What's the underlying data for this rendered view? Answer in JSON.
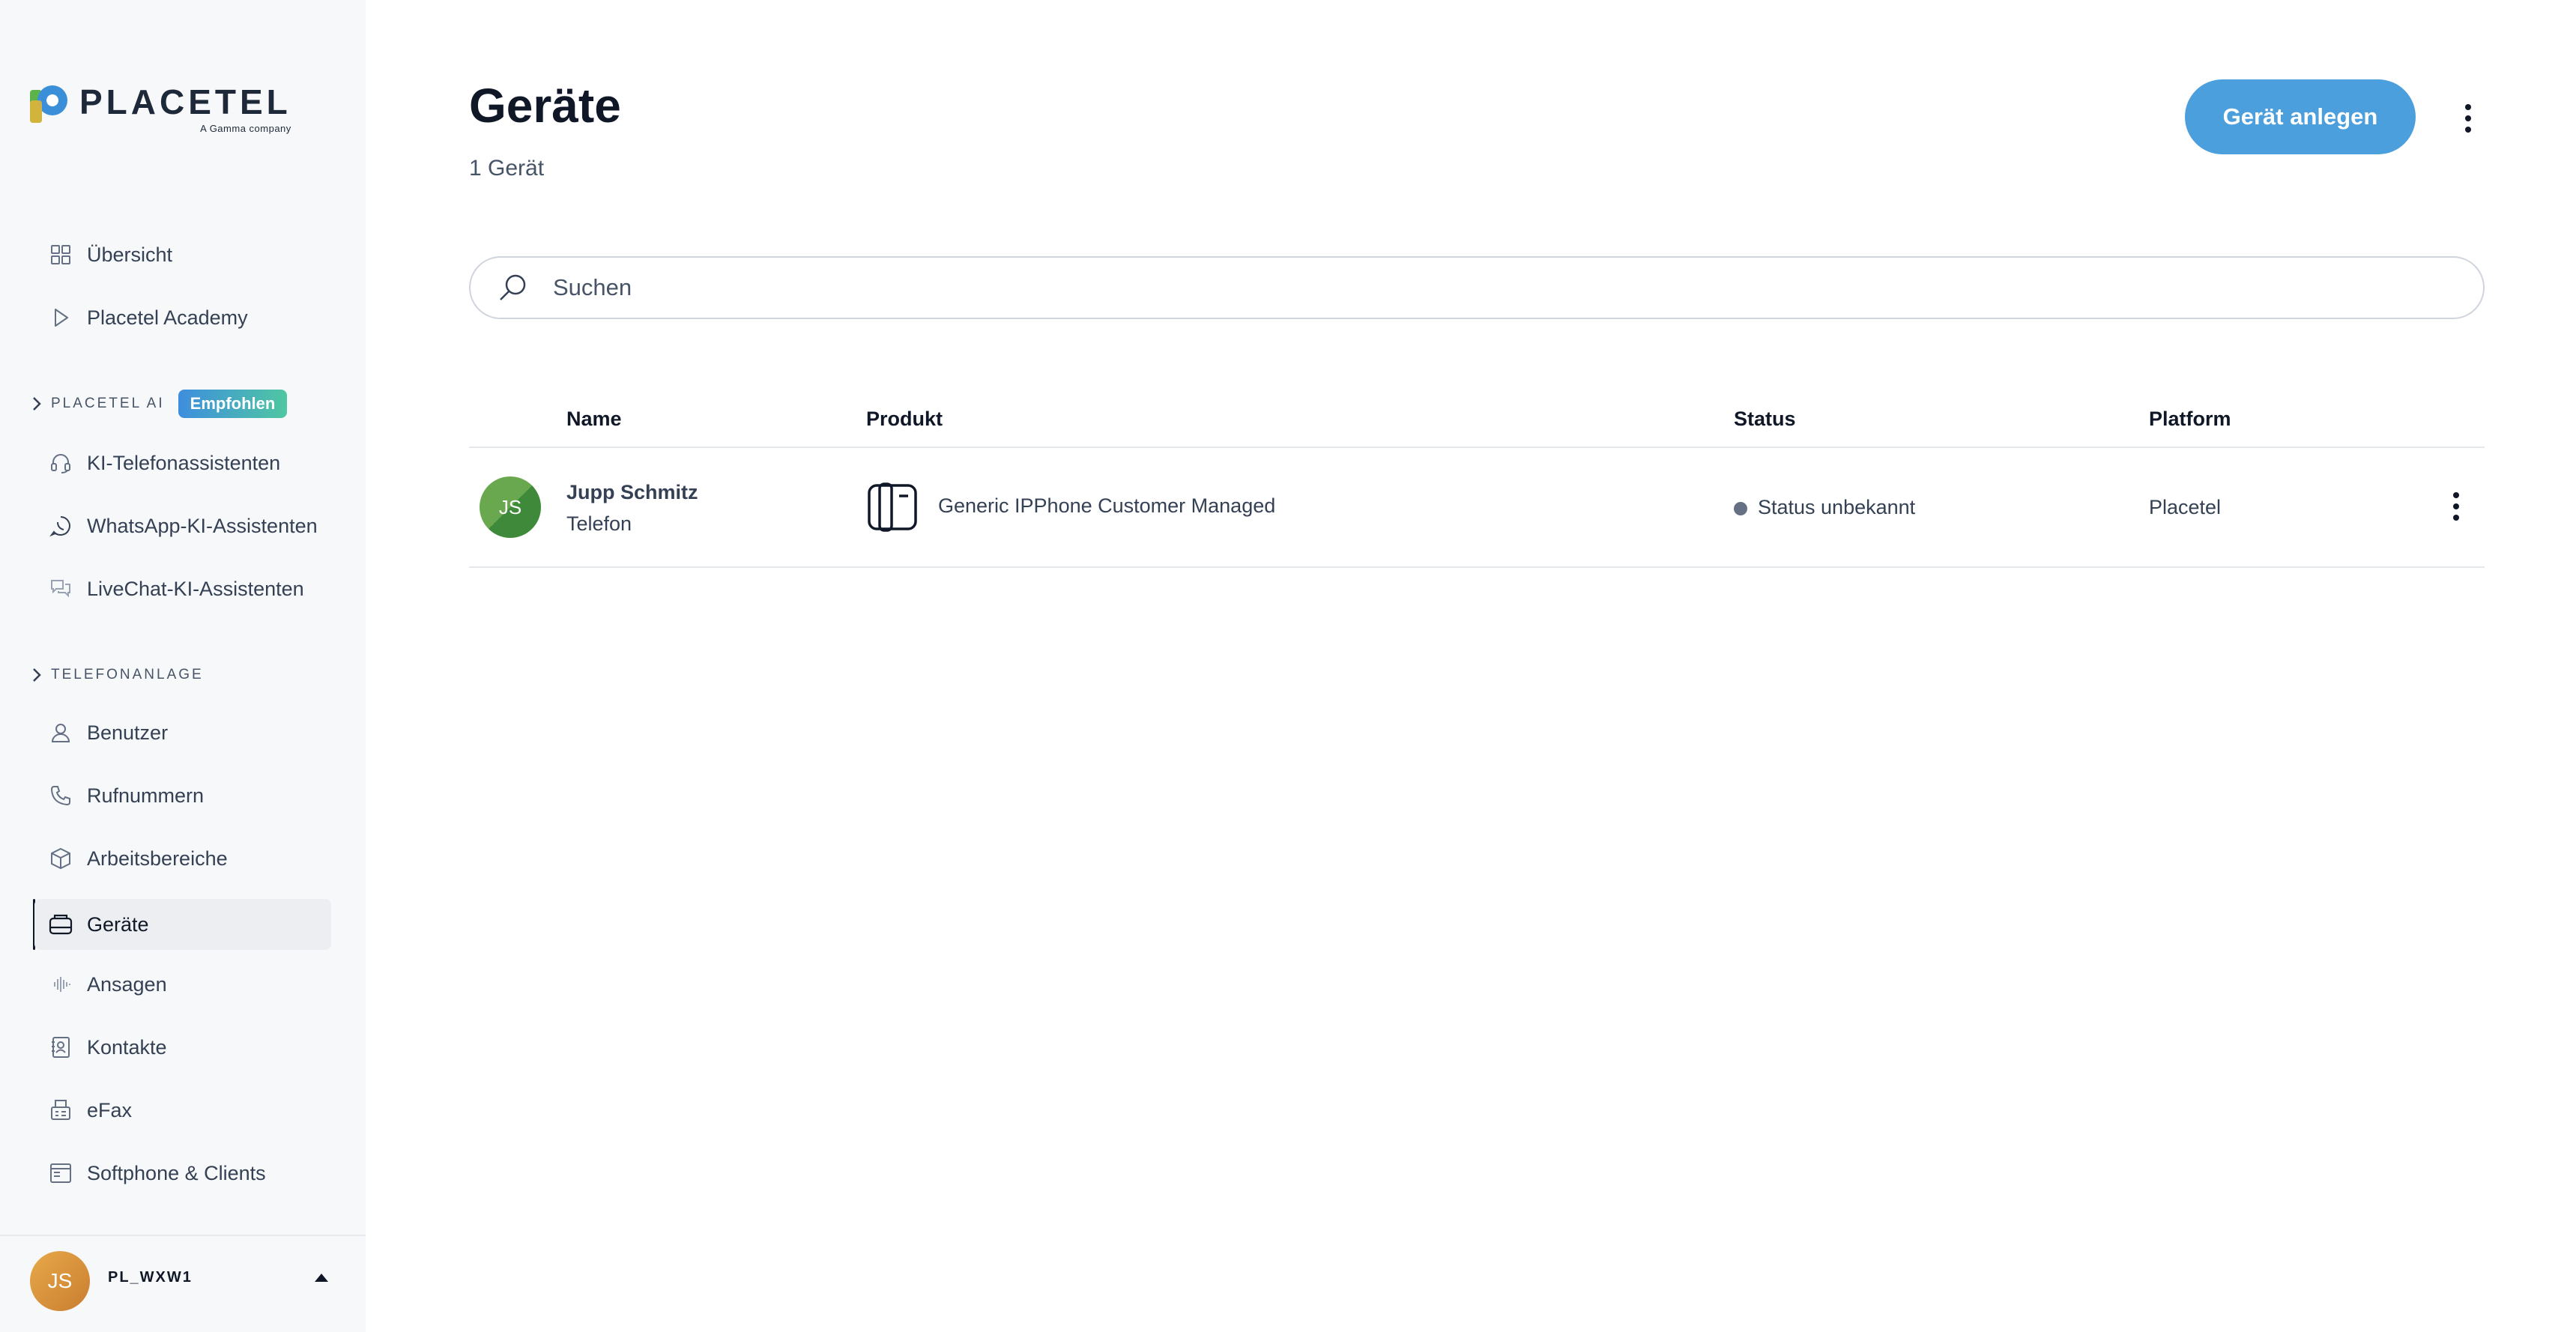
{
  "brand": {
    "name": "PLACETEL",
    "tagline": "A Gamma company"
  },
  "sidebar": {
    "top_items": [
      {
        "label": "Übersicht",
        "icon": "grid-icon"
      },
      {
        "label": "Placetel Academy",
        "icon": "play-icon"
      }
    ],
    "sections": [
      {
        "title": "PLACETEL AI",
        "badge": "Empfohlen"
      },
      {
        "title": "TELEFONANLAGE"
      }
    ],
    "ai_items": [
      {
        "label": "KI-Telefonassistenten",
        "icon": "headset-icon"
      },
      {
        "label": "WhatsApp-KI-Assistenten",
        "icon": "whatsapp-icon"
      },
      {
        "label": "LiveChat-KI-Assistenten",
        "icon": "chat-icon"
      }
    ],
    "pbx_items": [
      {
        "label": "Benutzer",
        "icon": "user-icon"
      },
      {
        "label": "Rufnummern",
        "icon": "phone-icon"
      },
      {
        "label": "Arbeitsbereiche",
        "icon": "cube-icon"
      },
      {
        "label": "Geräte",
        "icon": "device-icon",
        "active": true
      },
      {
        "label": "Ansagen",
        "icon": "waveform-icon"
      },
      {
        "label": "Kontakte",
        "icon": "contact-book-icon"
      },
      {
        "label": "eFax",
        "icon": "fax-icon"
      },
      {
        "label": "Softphone & Clients",
        "icon": "window-icon"
      }
    ],
    "account": {
      "initials": "JS",
      "name": "PL_WXW1"
    }
  },
  "main": {
    "title": "Geräte",
    "subtitle": "1 Gerät",
    "primary_button": "Gerät anlegen",
    "search_placeholder": "Suchen",
    "table": {
      "columns": [
        "Name",
        "Produkt",
        "Status",
        "Platform"
      ],
      "rows": [
        {
          "initials": "JS",
          "name": "Jupp Schmitz",
          "type": "Telefon",
          "product": "Generic IPPhone Customer Managed",
          "status": "Status unbekannt",
          "platform": "Placetel"
        }
      ]
    }
  },
  "colors": {
    "primary": "#4a9fdc",
    "sidebar_bg": "#f7f8fa",
    "avatar_green": "#6aa84f",
    "avatar_orange": "#e8a94a"
  }
}
